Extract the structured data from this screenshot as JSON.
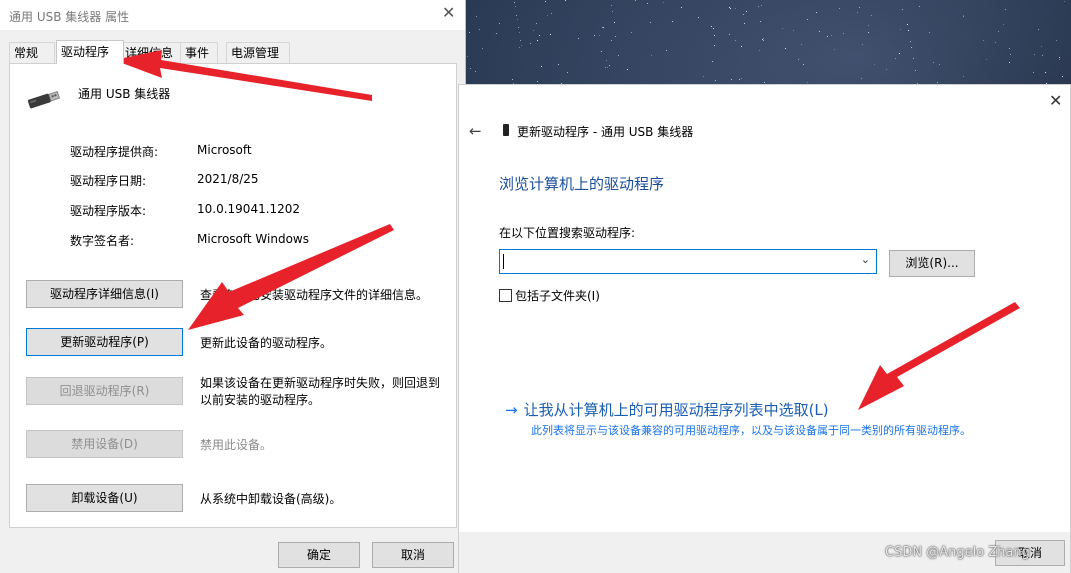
{
  "properties_dialog": {
    "title": "通用 USB 集线器 属性",
    "tabs": [
      {
        "label": "常规"
      },
      {
        "label": "驱动程序"
      },
      {
        "label": "详细信息"
      },
      {
        "label": "事件"
      },
      {
        "label": "电源管理"
      }
    ],
    "device_name": "通用 USB 集线器",
    "info": [
      {
        "label": "驱动程序提供商:",
        "value": "Microsoft"
      },
      {
        "label": "驱动程序日期:",
        "value": "2021/8/25"
      },
      {
        "label": "驱动程序版本:",
        "value": "10.0.19041.1202"
      },
      {
        "label": "数字签名者:",
        "value": "Microsoft Windows"
      }
    ],
    "actions": [
      {
        "label": "驱动程序详细信息(I)",
        "desc": "查看有关已安装驱动程序文件的详细信息。"
      },
      {
        "label": "更新驱动程序(P)",
        "desc": "更新此设备的驱动程序。"
      },
      {
        "label": "回退驱动程序(R)",
        "desc_line1": "如果该设备在更新驱动程序时失败，则回退到",
        "desc_line2": "以前安装的驱动程序。"
      },
      {
        "label": "禁用设备(D)",
        "desc": "禁用此设备。"
      },
      {
        "label": "卸载设备(U)",
        "desc": "从系统中卸载设备(高级)。"
      }
    ],
    "ok_label": "确定",
    "cancel_label": "取消"
  },
  "update_wizard": {
    "breadcrumb": "更新驱动程序 - 通用 USB 集线器",
    "heading": "浏览计算机上的驱动程序",
    "search_label": "在以下位置搜索驱动程序:",
    "path_value": "",
    "browse_label": "浏览(R)...",
    "include_subfolders_label": "包括子文件夹(I)",
    "include_subfolders_checked": false,
    "pick_link": "让我从计算机上的可用驱动程序列表中选取(L)",
    "pick_desc": "此列表将显示与该设备兼容的可用驱动程序，以及与该设备属于同一类别的所有驱动程序。",
    "cancel_label": "取消"
  },
  "watermark": "CSDN @Angelo Zhang",
  "colors": {
    "link": "#1a5fb4",
    "heading": "#1b4f9c",
    "annotation_arrow": "#e8222a"
  }
}
